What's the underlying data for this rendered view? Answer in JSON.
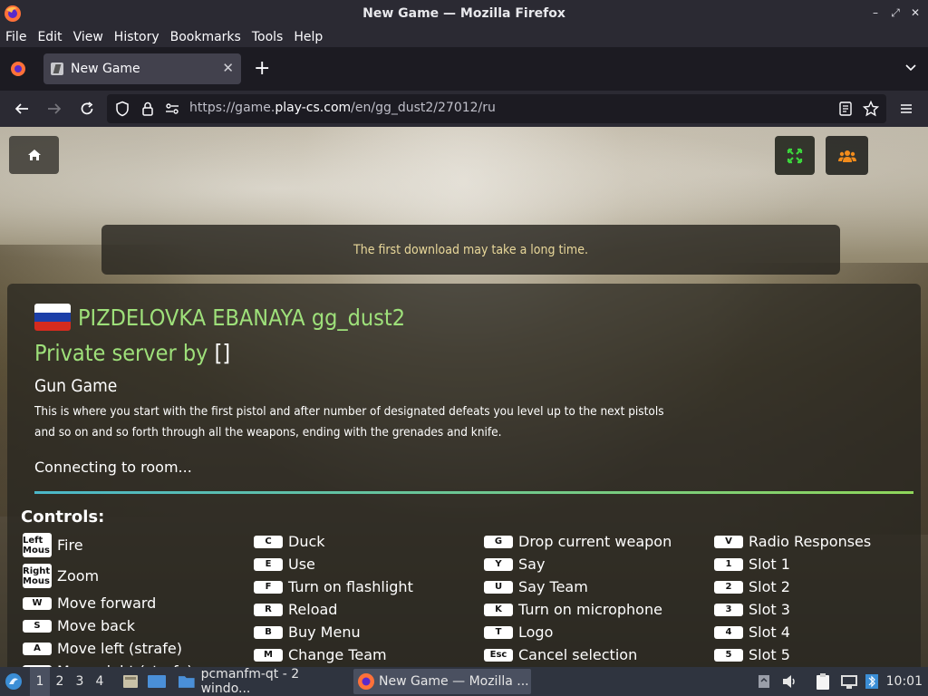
{
  "window": {
    "title": "New Game — Mozilla Firefox"
  },
  "menubar": {
    "items": [
      "File",
      "Edit",
      "View",
      "History",
      "Bookmarks",
      "Tools",
      "Help"
    ]
  },
  "tab": {
    "title": "New Game"
  },
  "urlbar": {
    "url_prefix": "https://game.",
    "url_domain": "play-cs.com",
    "url_path": "/en/gg_dust2/27012/ru"
  },
  "game": {
    "notice": "The first download may take a long time.",
    "server_name": "PIZDELOVKA EBANAYA gg_dust2",
    "private_label": "Private server by ",
    "private_owner": "[]",
    "mode": "Gun Game",
    "description": "This is where you start with the first pistol and after number of designated defeats you level up to the next pistols and so on and so forth through all the weapons, ending with the grenades and knife.",
    "status": "Connecting to room...",
    "controls_title": "Controls:",
    "controls": [
      {
        "key": "Left Mous",
        "label": "Fire",
        "mouse": true
      },
      {
        "key": "Right Mous",
        "label": "Zoom",
        "mouse": true
      },
      {
        "key": "W",
        "label": "Move forward"
      },
      {
        "key": "S",
        "label": "Move back"
      },
      {
        "key": "A",
        "label": "Move left (strafe)"
      },
      {
        "key": "D",
        "label": "Move right (strafe)"
      },
      {
        "key": "C",
        "label": "Duck"
      },
      {
        "key": "E",
        "label": "Use"
      },
      {
        "key": "F",
        "label": "Turn on flashlight"
      },
      {
        "key": "R",
        "label": "Reload"
      },
      {
        "key": "B",
        "label": "Buy Menu"
      },
      {
        "key": "M",
        "label": "Change Team"
      },
      {
        "key": "G",
        "label": "Drop current weapon"
      },
      {
        "key": "Y",
        "label": "Say"
      },
      {
        "key": "U",
        "label": "Say Team"
      },
      {
        "key": "K",
        "label": "Turn on microphone"
      },
      {
        "key": "T",
        "label": "Logo"
      },
      {
        "key": "Esc",
        "label": "Cancel selection"
      },
      {
        "key": "V",
        "label": "Radio Responses"
      },
      {
        "key": "1",
        "label": "Slot 1"
      },
      {
        "key": "2",
        "label": "Slot 2"
      },
      {
        "key": "3",
        "label": "Slot 3"
      },
      {
        "key": "4",
        "label": "Slot 4"
      },
      {
        "key": "5",
        "label": "Slot 5"
      }
    ]
  },
  "taskbar": {
    "workspaces": [
      "1",
      "2",
      "3",
      "4"
    ],
    "tasks": [
      "pcmanfm-qt - 2 windo...",
      "New Game — Mozilla ..."
    ],
    "clock": "10:01"
  },
  "colors": {
    "accent_green": "#9ee07a",
    "notice_text": "#e8d79a",
    "fullscreen_icon": "#3cd63c",
    "people_icon": "#f28c1c"
  }
}
